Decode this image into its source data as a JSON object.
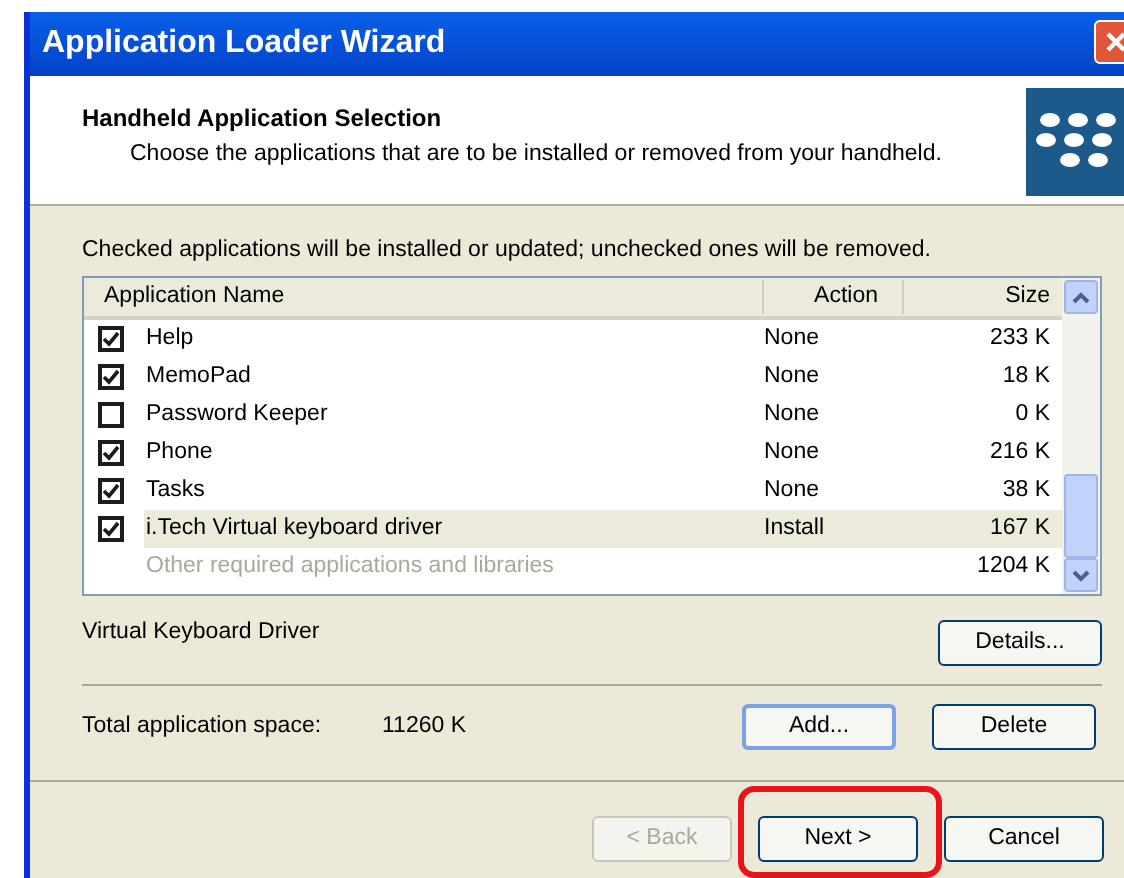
{
  "window": {
    "title": "Application Loader Wizard"
  },
  "header": {
    "title": "Handheld Application Selection",
    "subtitle": "Choose the applications that are to be installed or removed from your handheld."
  },
  "instruction": "Checked applications will be installed or updated; unchecked ones will be removed.",
  "table": {
    "columns": [
      "Application Name",
      "Action",
      "Size"
    ],
    "rows": [
      {
        "kind": "app",
        "name": "Help",
        "action": "None",
        "size": "233 K",
        "checked": true,
        "selected": false
      },
      {
        "kind": "app",
        "name": "MemoPad",
        "action": "None",
        "size": "18 K",
        "checked": true,
        "selected": false
      },
      {
        "kind": "app",
        "name": "Password Keeper",
        "action": "None",
        "size": "0 K",
        "checked": false,
        "selected": false
      },
      {
        "kind": "app",
        "name": "Phone",
        "action": "None",
        "size": "216 K",
        "checked": true,
        "selected": false
      },
      {
        "kind": "app",
        "name": "Tasks",
        "action": "None",
        "size": "38 K",
        "checked": true,
        "selected": false
      },
      {
        "kind": "app",
        "name": "i.Tech Virtual keyboard driver",
        "action": "Install",
        "size": "167 K",
        "checked": true,
        "selected": true
      },
      {
        "kind": "library",
        "name": "Other required applications and libraries",
        "size": "1204 K",
        "selected": false
      }
    ]
  },
  "description": "Virtual Keyboard Driver",
  "details_button": {
    "label": "Details..."
  },
  "total": {
    "label": "Total application space:",
    "value": "11260 K"
  },
  "add_button": {
    "label": "Add..."
  },
  "delete_button": {
    "label": "Delete"
  },
  "nav_buttons": [
    {
      "label": "< Back",
      "disabled": true,
      "highlighted": false
    },
    {
      "label": "Next >",
      "disabled": false,
      "highlighted": true
    },
    {
      "label": "Cancel",
      "disabled": false,
      "highlighted": false
    }
  ]
}
